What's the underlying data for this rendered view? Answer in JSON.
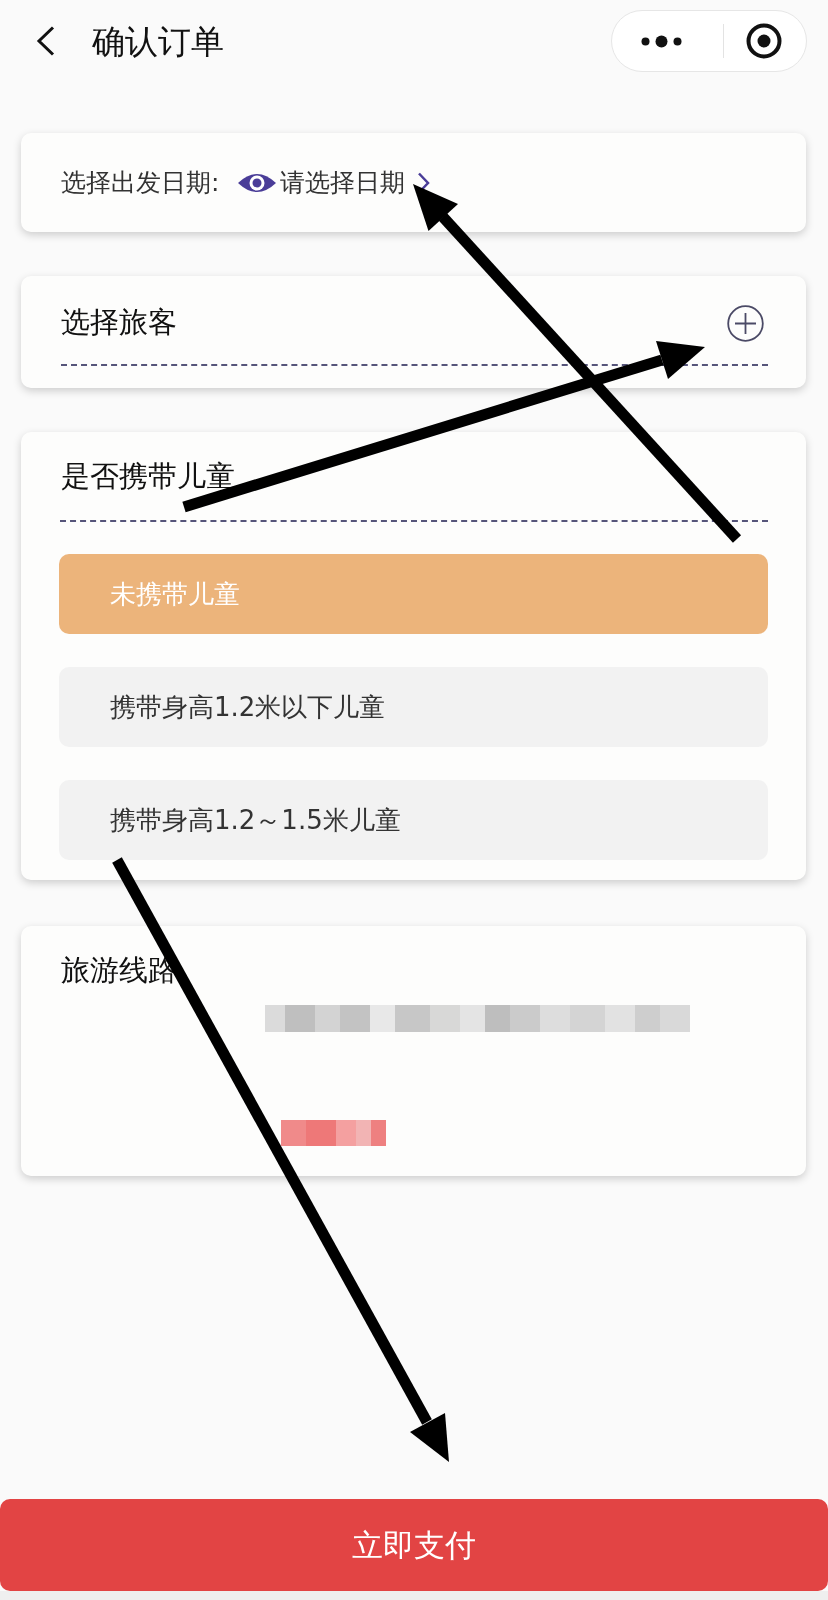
{
  "nav_bar": {
    "title": "确认订单"
  },
  "date_card": {
    "label": "选择出发日期:",
    "prompt": "请选择日期"
  },
  "travelers_card": {
    "title": "选择旅客"
  },
  "children_card": {
    "title": "是否携带儿童",
    "options": [
      {
        "label": "未携带儿童",
        "selected": true
      },
      {
        "label": "携带身高1.2米以下儿童",
        "selected": false
      },
      {
        "label": "携带身高1.2～1.5米儿童",
        "selected": false
      }
    ]
  },
  "route_card": {
    "title": "旅游线路"
  },
  "pay_button": {
    "label": "立即支付"
  }
}
